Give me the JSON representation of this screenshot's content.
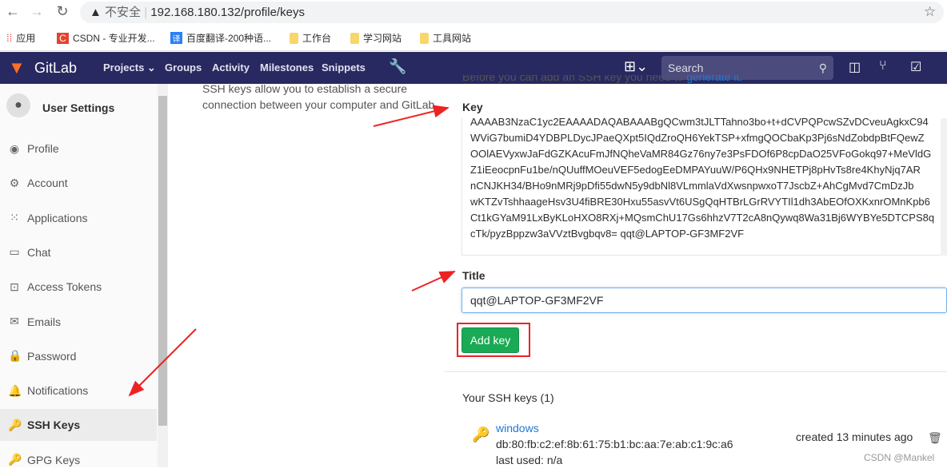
{
  "browser": {
    "insecure_label": "不安全",
    "url": "192.168.180.132/profile/keys",
    "bookmarks": [
      "应用",
      "CSDN - 专业开发...",
      "百度翻译-200种语...",
      "工作台",
      "学习网站",
      "工具网站"
    ]
  },
  "navbar": {
    "brand": "GitLab",
    "items": [
      "Projects",
      "Groups",
      "Activity",
      "Milestones",
      "Snippets"
    ],
    "search_placeholder": "Search"
  },
  "sidebar": {
    "title": "User Settings",
    "items": [
      {
        "label": "Profile",
        "icon": "profile-icon"
      },
      {
        "label": "Account",
        "icon": "account-icon"
      },
      {
        "label": "Applications",
        "icon": "applications-icon"
      },
      {
        "label": "Chat",
        "icon": "chat-icon"
      },
      {
        "label": "Access Tokens",
        "icon": "token-icon"
      },
      {
        "label": "Emails",
        "icon": "email-icon"
      },
      {
        "label": "Password",
        "icon": "lock-icon"
      },
      {
        "label": "Notifications",
        "icon": "bell-icon"
      },
      {
        "label": "SSH Keys",
        "icon": "key-icon",
        "active": true
      },
      {
        "label": "GPG Keys",
        "icon": "key-icon"
      }
    ]
  },
  "main": {
    "intro": "SSH keys allow you to establish a secure connection between your computer and GitLab.",
    "before_text": "Before you can add an SSH key you need to ",
    "generate_link": "generate it.",
    "key_label": "Key",
    "key_lines": [
      "AAAAB3NzaC1yc2EAAAADAQABAAABgQCwm3tJLTTahno3bo+t+dCVPQPcwSZvDCveuAgkxC94",
      "WViG7bumiD4YDBPLDycJPaeQXpt5IQdZroQH6YekTSP+xfmgQOCbaKp3Pj6sNdZobdpBtFQewZ",
      "OOlAEVyxwJaFdGZKAcuFmJfNQheVaMR84Gz76ny7e3PsFDOf6P8cpDaO25VFoGokq97+MeVldG",
      "Z1iEeocpnFu1be/nQUuffMOeuVEF5edogEeDMPAYuuW/P6QHx9NHETPj8pHvTs8re4KhyNjq7AR",
      "nCNJKH34/BHo9nMRj9pDfi55dwN5y9dbNl8VLmmlaVdXwsnpwxoT7JscbZ+AhCgMvd7CmDzJb",
      "wKTZvTshhaageHsv3U4fiBRE30Hxu55asvVt6USgQqHTBrLGrRVYTIl1dh3AbEOfOXKxnrOMnKpb6",
      "Ct1kGYaM91LxByKLoHXO8RXj+MQsmChU17Gs6hhzV7T2cA8nQywq8Wa31Bj6WYBYe5DTCPS8q",
      "cTk/pyzBppzw3aVVztBvgbqv8= qqt@LAPTOP-GF3MF2VF"
    ],
    "title_label": "Title",
    "title_value": "qqt@LAPTOP-GF3MF2VF",
    "add_button": "Add key",
    "your_keys_heading": "Your SSH keys (1)",
    "keys": [
      {
        "name": "windows",
        "fingerprint": "db:80:fb:c2:ef:8b:61:75:b1:bc:aa:7e:ab:c1:9c:a6",
        "last_used": "last used: n/a",
        "created": "created 13 minutes ago"
      }
    ]
  },
  "watermark": "CSDN @Mankel",
  "colors": {
    "navbar": "#292961",
    "accent_button": "#1aaa55",
    "annotation": "#ee2222",
    "link": "#1f78d1"
  }
}
